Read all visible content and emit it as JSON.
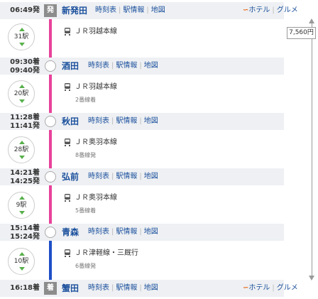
{
  "colors": {
    "line_pink": "#e8429a",
    "line_blue": "#1f4fc8",
    "link": "#1a4f9c",
    "header_bg": "#eef0f3",
    "arrow_green": "#58b04c"
  },
  "stations": [
    {
      "time_a": "06:49発",
      "time_b": "",
      "badge": "発",
      "name": "新発田",
      "links": [
        "時刻表",
        "駅情報",
        "地図"
      ],
      "hotel": true
    },
    {
      "time_a": "09:30着",
      "time_b": "09:40発",
      "badge": "",
      "name": "酒田",
      "links": [
        "時刻表",
        "駅情報",
        "地図"
      ],
      "hotel": false
    },
    {
      "time_a": "11:28着",
      "time_b": "11:41発",
      "badge": "",
      "name": "秋田",
      "links": [
        "時刻表",
        "駅情報",
        "地図"
      ],
      "hotel": false
    },
    {
      "time_a": "14:21着",
      "time_b": "14:25発",
      "badge": "",
      "name": "弘前",
      "links": [
        "時刻表",
        "駅情報",
        "地図"
      ],
      "hotel": false
    },
    {
      "time_a": "15:14着",
      "time_b": "15:24発",
      "badge": "",
      "name": "青森",
      "links": [
        "時刻表",
        "駅情報",
        "地図"
      ],
      "hotel": false
    },
    {
      "time_a": "16:18着",
      "time_b": "",
      "badge": "着",
      "name": "蟹田",
      "links": [
        "時刻表",
        "駅情報",
        "地図"
      ],
      "hotel": true
    }
  ],
  "segments": [
    {
      "stops": "31駅",
      "line": "ＪＲ羽越本線",
      "track": ""
    },
    {
      "stops": "20駅",
      "line": "ＪＲ羽越本線",
      "track": "2番線着"
    },
    {
      "stops": "28駅",
      "line": "ＪＲ奥羽本線",
      "track": "8番線発"
    },
    {
      "stops": "9駅",
      "line": "ＪＲ奥羽本線",
      "track": "5番線着"
    },
    {
      "stops": "10駅",
      "line": "ＪＲ津軽線・三厩行",
      "track": "6番線発"
    }
  ],
  "hotel_links": {
    "logo": "ホテル",
    "hotel": "ホテル",
    "gourmet": "グルメ"
  },
  "fare": "7,560円"
}
